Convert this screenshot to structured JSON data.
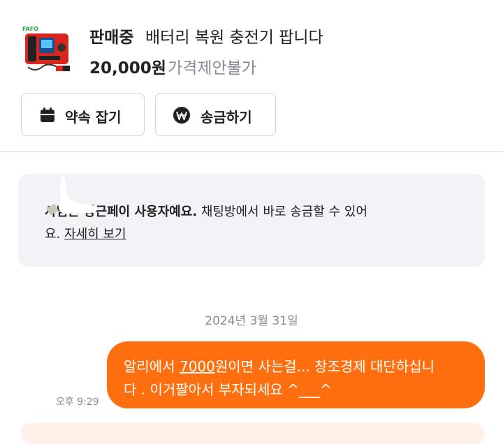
{
  "product": {
    "status": "판매중",
    "title": "배터리 복원 충전기 팝니다",
    "price": "20,000원",
    "negotiation": "가격제안불가"
  },
  "actions": {
    "promise_label": "약속 잡기",
    "send_money_label": "송금하기"
  },
  "notice": {
    "bold_text": "사님은 당근페이 사용자예요.",
    "text_line1": " 채팅방에서 바로 송금할 수 있어",
    "text_line2_prefix": "요. ",
    "link_text": "자세히 보기"
  },
  "chat": {
    "date": "2024년 3월 31일",
    "message": {
      "line1_prefix": "알리에서 ",
      "line1_underlined": "7000",
      "line1_suffix": "원이면 사는걸... 창조경제 대단하십니",
      "line2": "다 . 이거팔아서 부자되세요 ^___^",
      "time": "오후 9:29"
    }
  },
  "colors": {
    "accent": "#ff6f0f",
    "notice_bg": "#f2f3f6",
    "muted": "#868b94"
  },
  "icons": {
    "promise": "calendar-icon",
    "send_money": "won-icon"
  }
}
